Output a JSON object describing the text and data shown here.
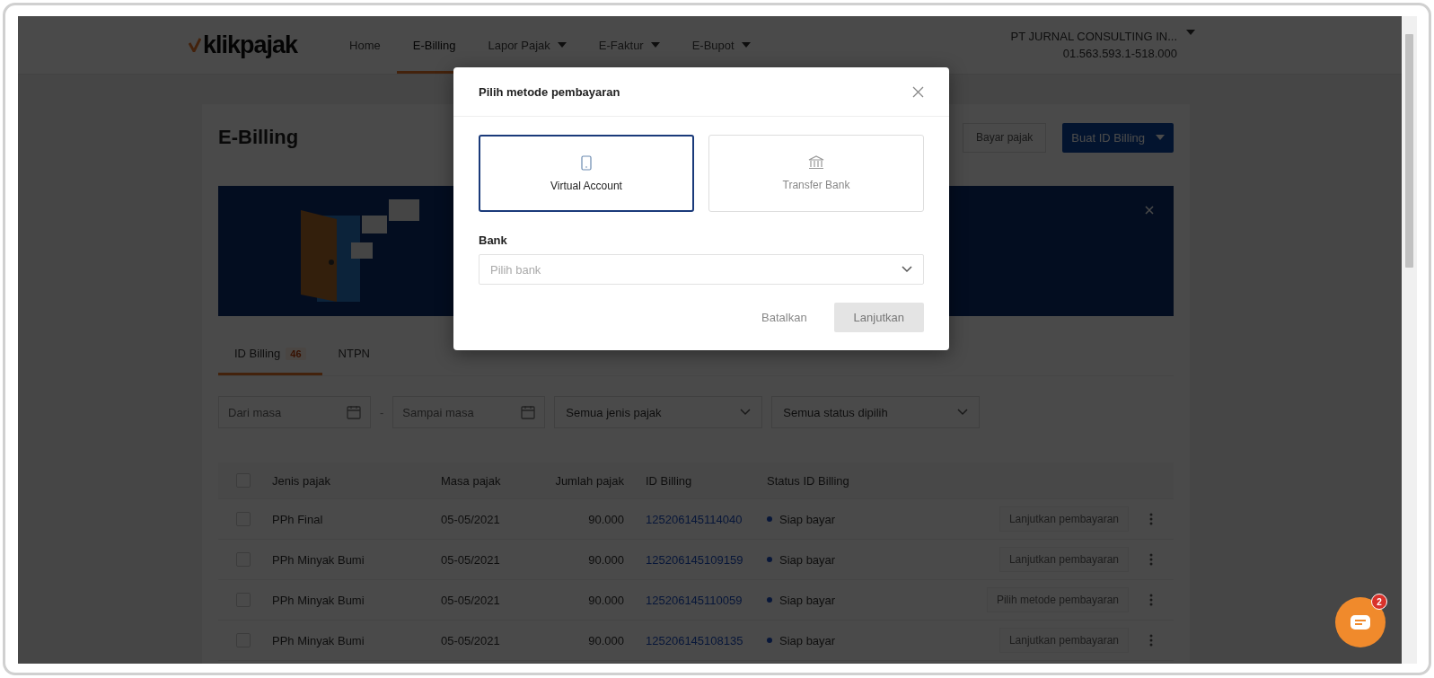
{
  "header": {
    "logo": "klikpajak",
    "nav": [
      {
        "label": "Home",
        "selected": false,
        "has_menu": false
      },
      {
        "label": "E-Billing",
        "selected": true,
        "has_menu": false
      },
      {
        "label": "Lapor Pajak",
        "selected": false,
        "has_menu": true
      },
      {
        "label": "E-Faktur",
        "selected": false,
        "has_menu": true
      },
      {
        "label": "E-Bupot",
        "selected": false,
        "has_menu": true
      }
    ],
    "company": "PT JURNAL CONSULTING IN...",
    "npwp": "01.563.593.1-518.000"
  },
  "page": {
    "title": "E-Billing",
    "pay_button": "Bayar pajak",
    "create_button": "Buat ID Billing"
  },
  "tabs": [
    {
      "label": "ID Billing",
      "badge": "46",
      "selected": true
    },
    {
      "label": "NTPN",
      "selected": false
    }
  ],
  "filters": {
    "from_placeholder": "Dari masa",
    "separator": "-",
    "to_placeholder": "Sampai masa",
    "tax_type": "Semua jenis pajak",
    "status": "Semua status dipilih"
  },
  "table": {
    "select_all": false,
    "columns": [
      "Jenis pajak",
      "Masa pajak",
      "Jumlah pajak",
      "ID Billing",
      "Status ID Billing"
    ],
    "rows": [
      {
        "checked": false,
        "type": "PPh Final",
        "period": "05-05/2021",
        "amount": "90.000",
        "id": "125206145114040",
        "status": "Siap bayar",
        "action": "Lanjutkan pembayaran"
      },
      {
        "checked": false,
        "type": "PPh Minyak Bumi",
        "period": "05-05/2021",
        "amount": "90.000",
        "id": "125206145109159",
        "status": "Siap bayar",
        "action": "Lanjutkan pembayaran"
      },
      {
        "checked": false,
        "type": "PPh Minyak Bumi",
        "period": "05-05/2021",
        "amount": "90.000",
        "id": "125206145110059",
        "status": "Siap bayar",
        "action": "Pilih metode pembayaran"
      },
      {
        "checked": false,
        "type": "PPh Minyak Bumi",
        "period": "05-05/2021",
        "amount": "90.000",
        "id": "125206145108135",
        "status": "Siap bayar",
        "action": "Lanjutkan pembayaran"
      }
    ]
  },
  "modal": {
    "title": "Pilih metode pembayaran",
    "methods": [
      {
        "label": "Virtual Account",
        "kind": "phone",
        "selected": true
      },
      {
        "label": "Transfer Bank",
        "kind": "bank",
        "selected": false
      }
    ],
    "bank_label": "Bank",
    "bank_placeholder": "Pilih bank",
    "cancel": "Batalkan",
    "continue": {
      "label": "Lanjutkan",
      "disabled": true
    }
  },
  "chat": {
    "badge": "2"
  }
}
